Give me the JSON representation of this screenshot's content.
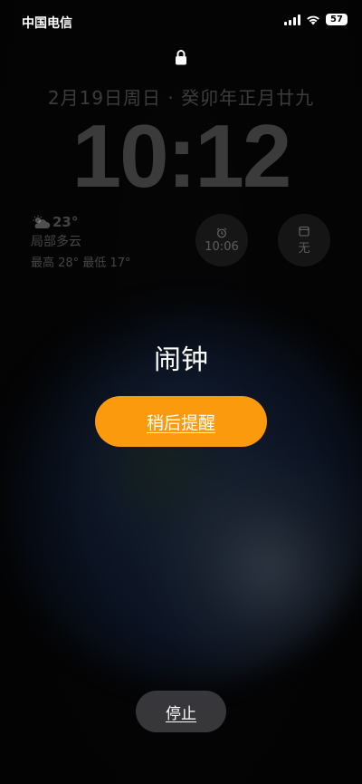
{
  "status_bar": {
    "carrier": "中国电信",
    "battery": "57",
    "icons": [
      "signal-icon",
      "wifi-icon",
      "battery-icon"
    ]
  },
  "lock_screen": {
    "lock_icon": "lock-icon",
    "date": "2月19日周日 · 癸卯年正月廿九",
    "time": "10:12"
  },
  "widgets": {
    "weather": {
      "icon": "partly-cloudy-icon",
      "temperature": "23°",
      "description": "局部多云",
      "range": "最高 28° 最低 17°"
    },
    "alarm": {
      "icon": "alarm-clock-icon",
      "label": "10:06"
    },
    "calendar": {
      "icon": "calendar-icon",
      "label": "无"
    }
  },
  "alarm_alert": {
    "title": "闹钟",
    "snooze_label": "稍后提醒",
    "stop_label": "停止"
  },
  "colors": {
    "snooze_button": "#fb9a0c",
    "background": "#050505"
  }
}
